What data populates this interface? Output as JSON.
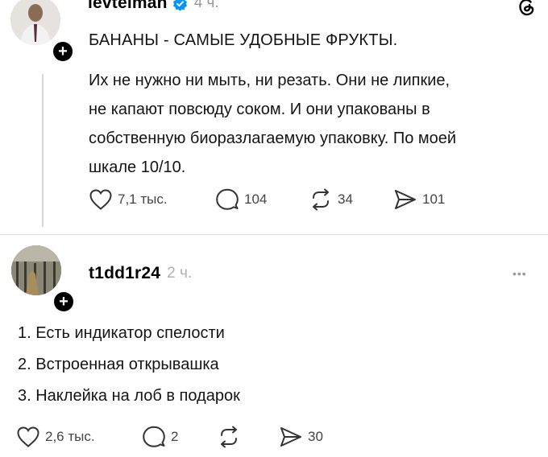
{
  "post": {
    "username": "levtelman",
    "time": "4 ч.",
    "title": "БАНАНЫ - САМЫЕ УДОБНЫЕ ФРУКТЫ.",
    "body_lines": [
      "Их не нужно ни мыть, ни резать. Они не липкие,",
      "не капают повсюду соком. И они упакованы в",
      "собственную биоразлагаемую упаковку. По моей",
      "шкале 10/10."
    ],
    "likes": "7,1 тыс.",
    "comments": "104",
    "reposts": "34",
    "shares": "101"
  },
  "reply": {
    "username": "t1dd1r24",
    "time": "2 ч.",
    "more": "•••",
    "items": [
      "1. Есть индикатор спелости",
      "2. Встроенная открывашка",
      "3. Наклейка на лоб в подарок"
    ],
    "likes": "2,6 тыс.",
    "comments": "2",
    "shares": "30"
  },
  "colors": {
    "verified": "#0095f6",
    "muted": "#9a9a9a"
  }
}
